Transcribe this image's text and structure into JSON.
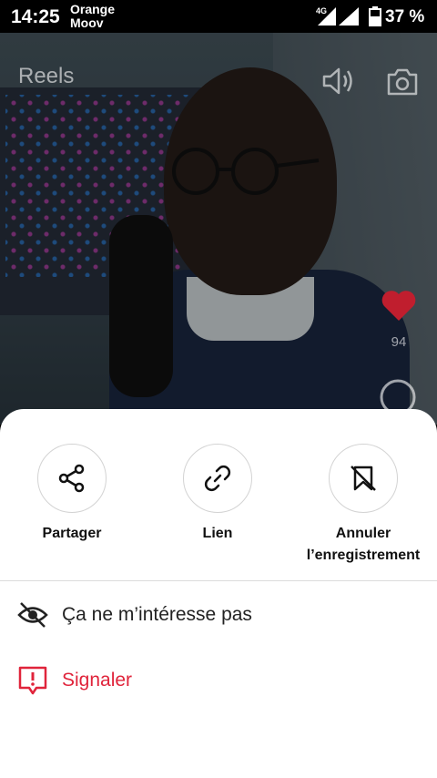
{
  "status_bar": {
    "time": "14:25",
    "carrier_line1": "Orange",
    "carrier_line2": "Moov",
    "network": "4G",
    "battery": "37 %"
  },
  "reel": {
    "title": "Reels",
    "likes": "94"
  },
  "sheet": {
    "actions": [
      {
        "label": "Partager",
        "icon": "share-icon"
      },
      {
        "label": "Lien",
        "icon": "link-icon"
      },
      {
        "label": "Annuler l’enregistrement",
        "icon": "unsave-icon"
      }
    ],
    "options": [
      {
        "label": "Ça ne m’intéresse pas",
        "icon": "eye-off-icon"
      },
      {
        "label": "Signaler",
        "icon": "report-icon",
        "color": "#e0243b"
      }
    ]
  }
}
